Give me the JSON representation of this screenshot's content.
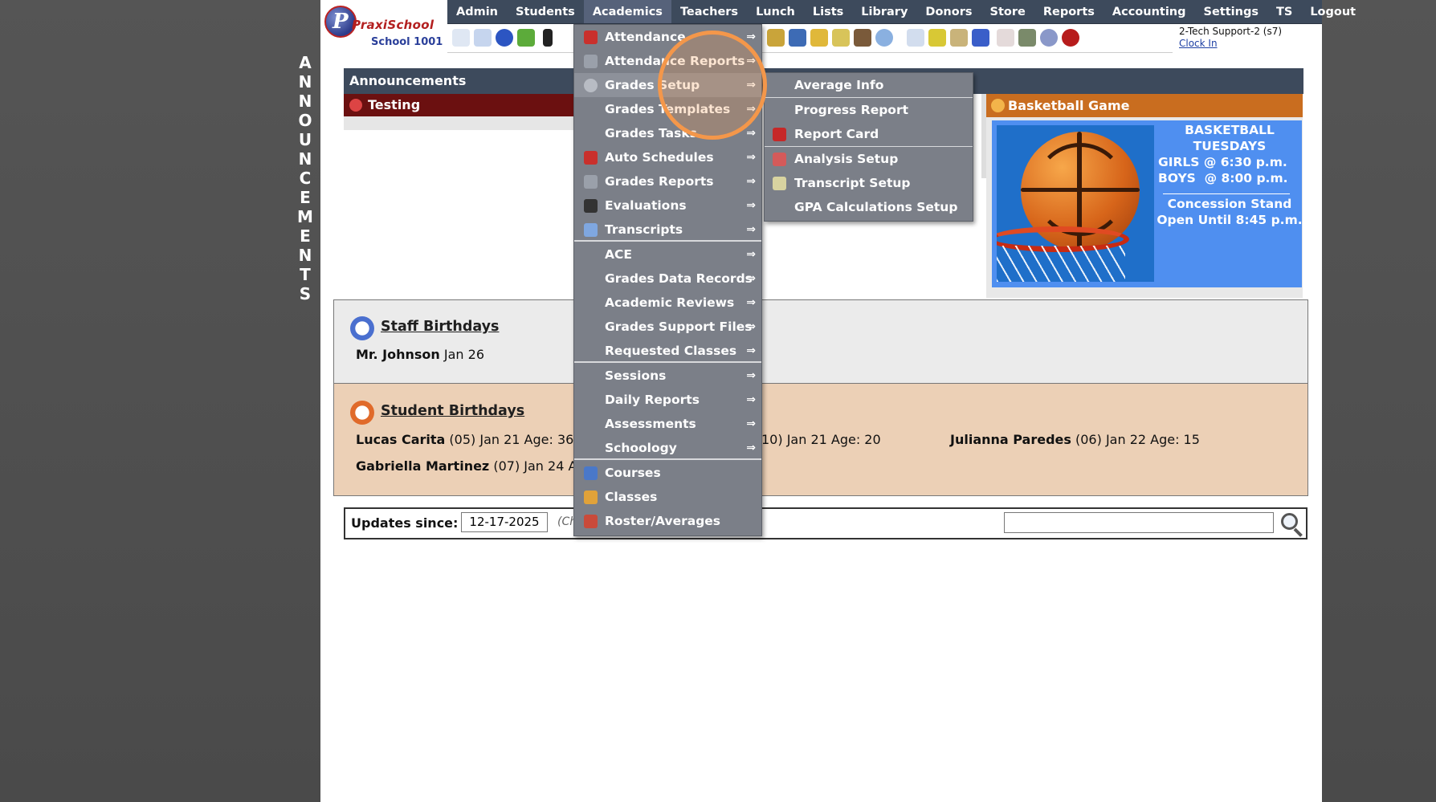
{
  "sidebar_vertical": [
    "A",
    "N",
    "N",
    "O",
    "U",
    "N",
    "C",
    "E",
    "M",
    "E",
    "N",
    "T",
    "S"
  ],
  "logo": {
    "brand": "PraxiSchool",
    "school": "School 1001"
  },
  "nav": [
    "Admin",
    "Students",
    "Academics",
    "Teachers",
    "Lunch",
    "Lists",
    "Library",
    "Donors",
    "Store",
    "Reports",
    "Accounting",
    "Settings",
    "TS",
    "Logout"
  ],
  "nav_active": "Academics",
  "user": {
    "name": "2-Tech Support-2 (s7)",
    "clock_in": "Clock In"
  },
  "announcements": {
    "header": "Announcements",
    "testing": "Testing",
    "basketball_title": "Basketball Game",
    "basketball_lines": [
      "BASKETBALL",
      "TUESDAYS",
      "GIRLS @ 6:30 p.m.",
      "BOYS  @ 8:00 p.m.",
      "Concession Stand",
      "Open Until 8:45 p.m."
    ]
  },
  "staff_birthdays": {
    "title": "Staff Birthdays",
    "rows": [
      {
        "name": "Mr. Johnson",
        "detail": " Jan 26"
      }
    ]
  },
  "student_birthdays": {
    "title": "Student Birthdays",
    "rows": [
      {
        "name": "Lucas Carita",
        "detail": " (05) Jan 21 Age: 36"
      },
      {
        "name": "",
        "detail": "10) Jan 21 Age: 20"
      },
      {
        "name": "Julianna Paredes",
        "detail": " (06) Jan 22 Age: 15"
      },
      {
        "name": "Gabriella Martinez",
        "detail": " (07) Jan 24 Ag"
      }
    ]
  },
  "updates": {
    "label": "Updates since:",
    "date": "12-17-2025",
    "hint": "(Ch",
    "search_value": ""
  },
  "menu": {
    "arrow": "⇒",
    "items": [
      {
        "label": "Attendance",
        "icon": "calendar-icon",
        "color": "#c9302c"
      },
      {
        "label": "Attendance Reports",
        "icon": "printer-icon",
        "color": "#9aa0aa"
      },
      {
        "label": "Grades Setup",
        "icon": "gear-icon",
        "color": "#b8bcc4"
      },
      {
        "label": "Grades Templates",
        "icon": "",
        "color": ""
      },
      {
        "label": "Grades Tasks",
        "icon": "",
        "color": ""
      },
      {
        "label": "Auto Schedules",
        "icon": "schedule-icon",
        "color": "#c9302c"
      },
      {
        "label": "Grades Reports",
        "icon": "printer-icon",
        "color": "#9aa0aa"
      },
      {
        "label": "Evaluations",
        "icon": "checkbox-icon",
        "color": "#333"
      },
      {
        "label": "Transcripts",
        "icon": "document-icon",
        "color": "#7fa7e0"
      },
      {
        "label": "ACE",
        "icon": "",
        "color": ""
      },
      {
        "label": "Grades Data Records",
        "icon": "",
        "color": ""
      },
      {
        "label": "Academic Reviews",
        "icon": "",
        "color": ""
      },
      {
        "label": "Grades Support Files",
        "icon": "",
        "color": ""
      },
      {
        "label": "Requested Classes",
        "icon": "",
        "color": ""
      },
      {
        "label": "Sessions",
        "icon": "",
        "color": ""
      },
      {
        "label": "Daily Reports",
        "icon": "",
        "color": ""
      },
      {
        "label": "Assessments",
        "icon": "",
        "color": ""
      },
      {
        "label": "Schoology",
        "icon": "",
        "color": ""
      },
      {
        "label": "Courses",
        "icon": "book-icon",
        "color": "#4a78c9"
      },
      {
        "label": "Classes",
        "icon": "teacher-icon",
        "color": "#e0a23a"
      },
      {
        "label": "Roster/Averages",
        "icon": "roster-icon",
        "color": "#c94a3a"
      }
    ]
  },
  "submenu": {
    "items": [
      {
        "label": "Average Info",
        "icon": ""
      },
      {
        "label": "Progress Report",
        "icon": ""
      },
      {
        "label": "Report Card",
        "icon": "grade-a-plus-icon"
      },
      {
        "label": "Analysis Setup",
        "icon": "chart-icon"
      },
      {
        "label": "Transcript Setup",
        "icon": "document-icon"
      },
      {
        "label": "GPA Calculations Setup",
        "icon": ""
      }
    ]
  }
}
